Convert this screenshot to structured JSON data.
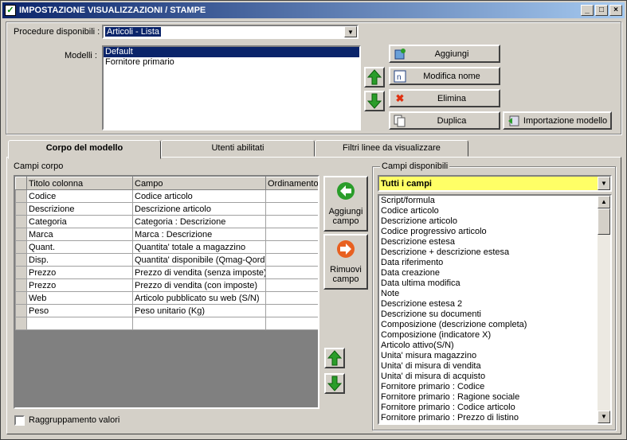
{
  "window": {
    "title": "IMPOSTAZIONE VISUALIZZAZIONI / STAMPE",
    "min_glyph": "_",
    "max_glyph": "□",
    "close_glyph": "×"
  },
  "top": {
    "procedure_label": "Procedure disponibili :",
    "procedure_value": "Articoli - Lista",
    "modelli_label": "Modelli :",
    "modelli": [
      "Default",
      "Fornitore primario"
    ],
    "selected_modello": 0,
    "buttons": {
      "aggiungi": "Aggiungi",
      "modifica_nome": "Modifica nome",
      "elimina": "Elimina",
      "duplica": "Duplica",
      "importazione": "Importazione modello"
    }
  },
  "tabs": [
    "Corpo del modello",
    "Utenti abilitati",
    "Filtri linee da visualizzare"
  ],
  "active_tab": 0,
  "campi_corpo": {
    "label": "Campi corpo",
    "columns": [
      "Titolo colonna",
      "Campo",
      "Ordinamento"
    ],
    "rows": [
      [
        "Codice",
        "Codice articolo",
        ""
      ],
      [
        "Descrizione",
        "Descrizione articolo",
        ""
      ],
      [
        "Categoria",
        "Categoria : Descrizione",
        ""
      ],
      [
        "Marca",
        "Marca : Descrizione",
        ""
      ],
      [
        "Quant.",
        "Quantita' totale a magazzino",
        ""
      ],
      [
        "Disp.",
        "Quantita' disponibile (Qmag-Qord)",
        ""
      ],
      [
        "Prezzo",
        "Prezzo di vendita (senza imposte)",
        ""
      ],
      [
        "Prezzo",
        "Prezzo di vendita (con imposte)",
        ""
      ],
      [
        "Web",
        "Articolo pubblicato su web (S/N)",
        ""
      ],
      [
        "Peso",
        "Peso unitario (Kg)",
        ""
      ],
      [
        "",
        "",
        ""
      ]
    ]
  },
  "middle_buttons": {
    "aggiungi_campo_1": "Aggiungi",
    "aggiungi_campo_2": "campo",
    "rimuovi_campo_1": "Rimuovi",
    "rimuovi_campo_2": "campo"
  },
  "raggruppamento_label": "Raggruppamento valori",
  "campi_disponibili": {
    "label": "Campi disponibili",
    "filter_value": "Tutti i campi",
    "items": [
      "Script/formula",
      "Codice articolo",
      "Descrizione articolo",
      "Codice progressivo articolo",
      "Descrizione estesa",
      "Descrizione + descrizione estesa",
      "Data riferimento",
      "Data creazione",
      "Data ultima modifica",
      "Note",
      "Descrizione estesa 2",
      "Descrizione su documenti",
      "Composizione (descrizione completa)",
      "Composizione (indicatore X)",
      "Articolo attivo(S/N)",
      "Unita' misura magazzino",
      "Unita' di misura di vendita",
      "Unita' di misura di acquisto",
      "Fornitore primario : Codice",
      "Fornitore primario : Ragione sociale",
      "Fornitore primario : Codice articolo",
      "Fornitore primario : Prezzo di listino"
    ]
  },
  "colors": {
    "titlebar_start": "#0a246a",
    "titlebar_end": "#a6caf0",
    "selection": "#0a246a",
    "filter_bg": "#ffff66",
    "arrow_green": "#2a9d2a",
    "action_orange": "#e86020"
  }
}
